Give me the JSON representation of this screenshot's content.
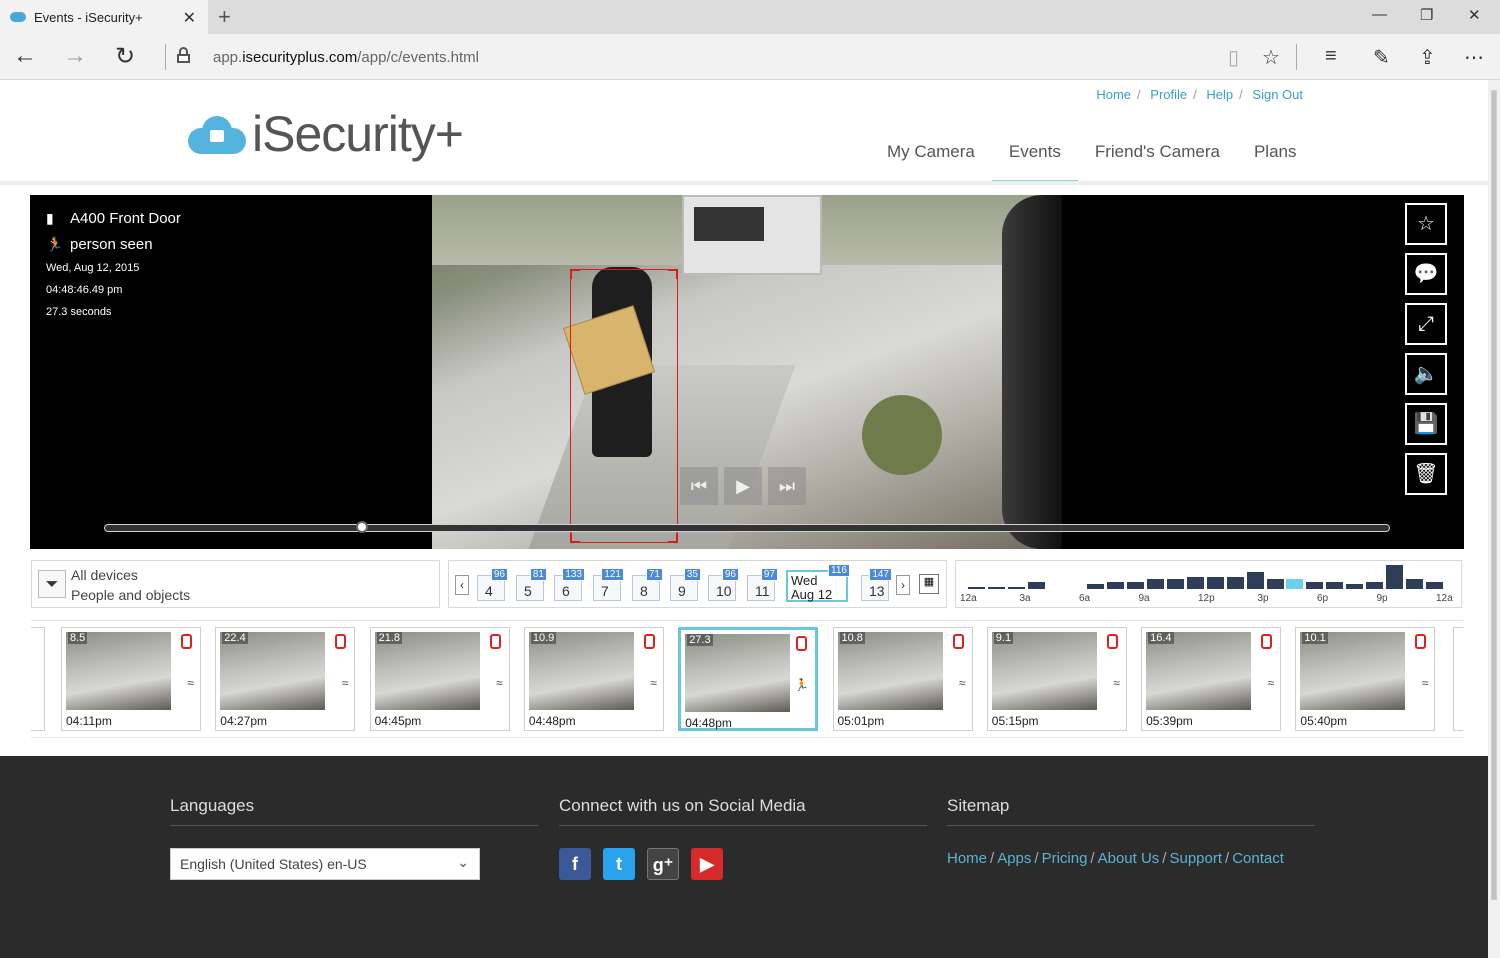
{
  "browser": {
    "tab_title": "Events - iSecurity+",
    "url_domain_prefix": "app.",
    "url_domain_main": "isecurityplus.com",
    "url_path": "/app/c/events.html"
  },
  "header": {
    "toplinks": [
      "Home",
      "Profile",
      "Help",
      "Sign Out"
    ],
    "logo_text": "iSecurity+",
    "nav": [
      "My Camera",
      "Events",
      "Friend's Camera",
      "Plans"
    ],
    "active_nav": "Events"
  },
  "video": {
    "camera_name": "A400 Front Door",
    "event_type": "person seen",
    "date": "Wed, Aug 12, 2015",
    "time": "04:48:46.49 pm",
    "duration": "27.3 seconds",
    "progress": 0.2
  },
  "filter": {
    "devices": "All devices",
    "objects": "People and objects"
  },
  "days": [
    {
      "day": "4",
      "count": "96"
    },
    {
      "day": "5",
      "count": "81"
    },
    {
      "day": "6",
      "count": "133"
    },
    {
      "day": "7",
      "count": "121"
    },
    {
      "day": "8",
      "count": "71"
    },
    {
      "day": "9",
      "count": "35"
    },
    {
      "day": "10",
      "count": "96"
    },
    {
      "day": "11",
      "count": "97"
    },
    {
      "day": "Aug 12",
      "weekday": "Wed",
      "count": "116",
      "selected": true
    },
    {
      "day": "13",
      "count": "147"
    }
  ],
  "histogram": {
    "labels": [
      "12a",
      "3a",
      "6a",
      "9a",
      "12p",
      "3p",
      "6p",
      "9p",
      "12a"
    ],
    "values": [
      1,
      1,
      1,
      3,
      0,
      0,
      2,
      3,
      3,
      4,
      4,
      5,
      5,
      5,
      7,
      4,
      4,
      3,
      3,
      2,
      3,
      10,
      4,
      3
    ],
    "highlight_index": 16,
    "bar_color": "#2f3e58",
    "highlight_color": "#6ad0ec"
  },
  "thumbnails": [
    {
      "duration": "8.5",
      "time": "04:11pm"
    },
    {
      "duration": "22.4",
      "time": "04:27pm"
    },
    {
      "duration": "21.8",
      "time": "04:45pm"
    },
    {
      "duration": "10.9",
      "time": "04:48pm"
    },
    {
      "duration": "27.3",
      "time": "04:48pm",
      "selected": true
    },
    {
      "duration": "10.8",
      "time": "05:01pm"
    },
    {
      "duration": "9.1",
      "time": "05:15pm"
    },
    {
      "duration": "16.4",
      "time": "05:39pm"
    },
    {
      "duration": "10.1",
      "time": "05:40pm"
    }
  ],
  "footer": {
    "languages_title": "Languages",
    "language_value": "English (United States) en-US",
    "social_title": "Connect with us on Social Media",
    "sitemap_title": "Sitemap",
    "sitemap_links": [
      "Home",
      "Apps",
      "Pricing",
      "About Us",
      "Support",
      "Contact"
    ]
  },
  "colors": {
    "accent": "#3aa0c8",
    "nav_underline": "#8dd0e3",
    "footer_bg": "#2b2b2b"
  }
}
